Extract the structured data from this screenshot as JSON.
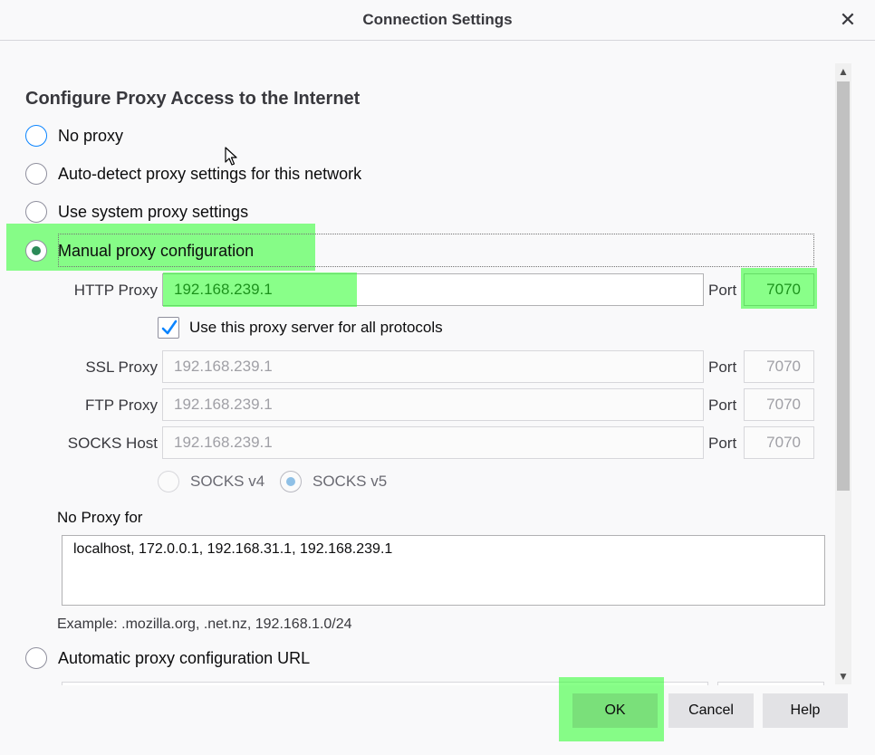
{
  "window": {
    "title": "Connection Settings",
    "close_glyph": "✕"
  },
  "heading": "Configure Proxy Access to the Internet",
  "options": {
    "no_proxy": "No proxy",
    "auto_detect": "Auto-detect proxy settings for this network",
    "system": "Use system proxy settings",
    "manual": "Manual proxy configuration",
    "auto_url": "Automatic proxy configuration URL"
  },
  "manual": {
    "http_label": "HTTP Proxy",
    "http_value": "192.168.239.1",
    "port_label": "Port",
    "http_port": "7070",
    "use_all_label": "Use this proxy server for all protocols",
    "ssl_label": "SSL Proxy",
    "ssl_value": "192.168.239.1",
    "ssl_port": "7070",
    "ftp_label": "FTP Proxy",
    "ftp_value": "192.168.239.1",
    "ftp_port": "7070",
    "socks_label": "SOCKS Host",
    "socks_value": "192.168.239.1",
    "socks_port": "7070",
    "socks_v4": "SOCKS v4",
    "socks_v5": "SOCKS v5"
  },
  "no_proxy": {
    "label": "No Proxy for",
    "value": "localhost, 172.0.0.1, 192.168.31.1, 192.168.239.1",
    "example": "Example: .mozilla.org, .net.nz, 192.168.1.0/24"
  },
  "buttons": {
    "ok": "OK",
    "cancel": "Cancel",
    "help": "Help"
  },
  "colors": {
    "highlight": "#28ff28",
    "accent": "#0a84ff",
    "radio_checked": "#2c8a58"
  },
  "icons": {
    "close": "close-icon",
    "check": "checkmark-icon",
    "cursor": "mouse-pointer-icon"
  }
}
